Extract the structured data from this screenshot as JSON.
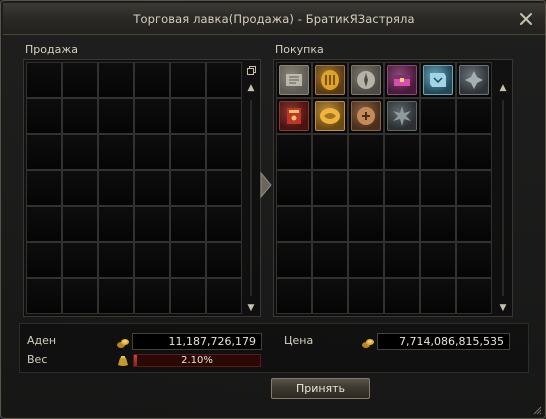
{
  "window": {
    "title": "Торговая лавка(Продажа) - БратикЯЗастряла"
  },
  "sell": {
    "label": "Продажа",
    "columns": 6,
    "rows": 7
  },
  "buy": {
    "label": "Покупка",
    "columns": 6,
    "rows": 7,
    "items": [
      {
        "name": "scroll-icon",
        "bg": "#5c5a55",
        "fg": "#c9c4b8",
        "border": "#8b8577"
      },
      {
        "name": "golden-shield-icon",
        "bg": "#5a3a12",
        "fg": "#e0a326",
        "border": "#a07a32"
      },
      {
        "name": "silver-orb-icon",
        "bg": "#4c4a46",
        "fg": "#b7b2a8",
        "border": "#7d776b"
      },
      {
        "name": "magenta-chest-icon",
        "bg": "#4a1a3a",
        "fg": "#d64fb0",
        "border": "#8a4a7a"
      },
      {
        "name": "blue-scroll-icon",
        "bg": "#23485a",
        "fg": "#9fd6e6",
        "border": "#6aa6b6"
      },
      {
        "name": "dark-scroll-icon",
        "bg": "#2e3338",
        "fg": "#a6b0b4",
        "border": "#6d757a"
      },
      {
        "name": "red-book-icon",
        "bg": "#4a1210",
        "fg": "#c0352a",
        "border": "#8a3a32"
      },
      {
        "name": "gold-talisman-icon",
        "bg": "#6a4a12",
        "fg": "#f0b43a",
        "border": "#c09040"
      },
      {
        "name": "bronze-medal-icon",
        "bg": "#4a2e1c",
        "fg": "#c48a58",
        "border": "#8a6446"
      },
      {
        "name": "spiked-rune-icon",
        "bg": "#2b2f32",
        "fg": "#8f9a9e",
        "border": "#5f676b"
      }
    ]
  },
  "adena": {
    "label": "Аден",
    "value": "11,187,726,179"
  },
  "weight": {
    "label": "Вес",
    "value": "2.10%",
    "fraction": 0.021
  },
  "price": {
    "label": "Цена",
    "value": "7,714,086,815,535"
  },
  "accept_label": "Принять",
  "colors": {
    "accent": "#d6cfbe",
    "weight_bar": "#c34236",
    "coin": "#e0b23a"
  }
}
